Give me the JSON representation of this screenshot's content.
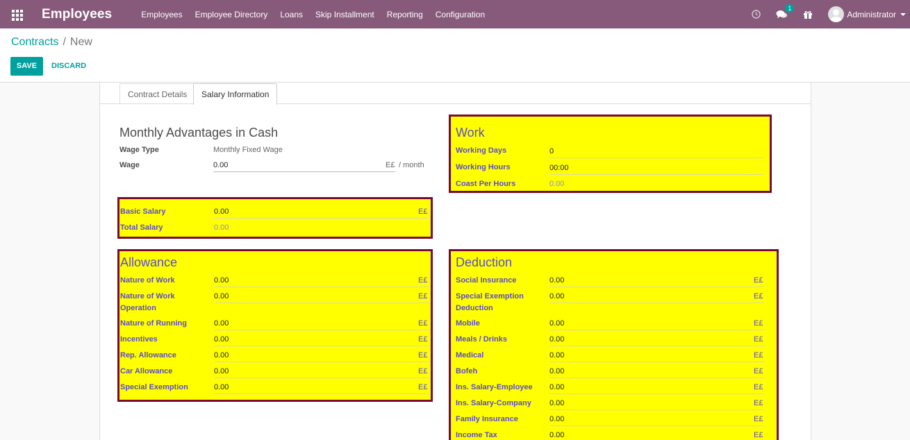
{
  "navbar": {
    "app_title": "Employees",
    "menu": [
      "Employees",
      "Employee Directory",
      "Loans",
      "Skip Installment",
      "Reporting",
      "Configuration"
    ],
    "message_badge": "1",
    "user_name": "Administrator",
    "bg_color": "#875a7b"
  },
  "control": {
    "breadcrumb_parent": "Contracts",
    "breadcrumb_sep": "/",
    "breadcrumb_current": "New",
    "save_label": "SAVE",
    "discard_label": "DISCARD"
  },
  "tabs": [
    "Contract Details",
    "Salary Information"
  ],
  "advantages": {
    "title": "Monthly Advantages in Cash",
    "wage_type_label": "Wage Type",
    "wage_type_value": "Monthly Fixed Wage",
    "wage_label": "Wage",
    "wage_value": "0.00",
    "currency": "E£",
    "period": "/ month"
  },
  "salary": {
    "basic_label": "Basic Salary",
    "basic_value": "0.00",
    "total_label": "Total Salary",
    "total_value": "0.00"
  },
  "work": {
    "title": "Work",
    "days_label": "Working Days",
    "days_value": "0",
    "hours_label": "Working Hours",
    "hours_value": "00:00",
    "coast_label": "Coast Per Hours",
    "coast_value": "0.00"
  },
  "allowance": {
    "title": "Allowance",
    "rows": [
      {
        "label": "Nature of Work",
        "value": "0.00"
      },
      {
        "label": "Nature of Work Operation",
        "value": "0.00"
      },
      {
        "label": "Nature of Running",
        "value": "0.00"
      },
      {
        "label": "Incentives",
        "value": "0.00"
      },
      {
        "label": "Rep. Allowance",
        "value": "0.00"
      },
      {
        "label": "Car Allowance",
        "value": "0.00"
      },
      {
        "label": "Special Exemption",
        "value": "0.00"
      }
    ]
  },
  "deduction": {
    "title": "Deduction",
    "rows": [
      {
        "label": "Social Insurance",
        "value": "0.00"
      },
      {
        "label": "Special Exemption Deduction",
        "value": "0.00"
      },
      {
        "label": "Mobile",
        "value": "0.00"
      },
      {
        "label": "Meals / Drinks",
        "value": "0.00"
      },
      {
        "label": "Medical",
        "value": "0.00"
      },
      {
        "label": "Bofeh",
        "value": "0.00"
      },
      {
        "label": "Ins. Salary-Employee",
        "value": "0.00"
      },
      {
        "label": "Ins. Salary-Company",
        "value": "0.00"
      },
      {
        "label": "Family Insurance",
        "value": "0.00"
      },
      {
        "label": "Income Tax",
        "value": "0.00"
      }
    ]
  },
  "colors": {
    "accent": "#00a09d",
    "highlight": "#ffff00",
    "highlight_border": "#7a0a30",
    "label_blue": "#5a4cc8"
  }
}
